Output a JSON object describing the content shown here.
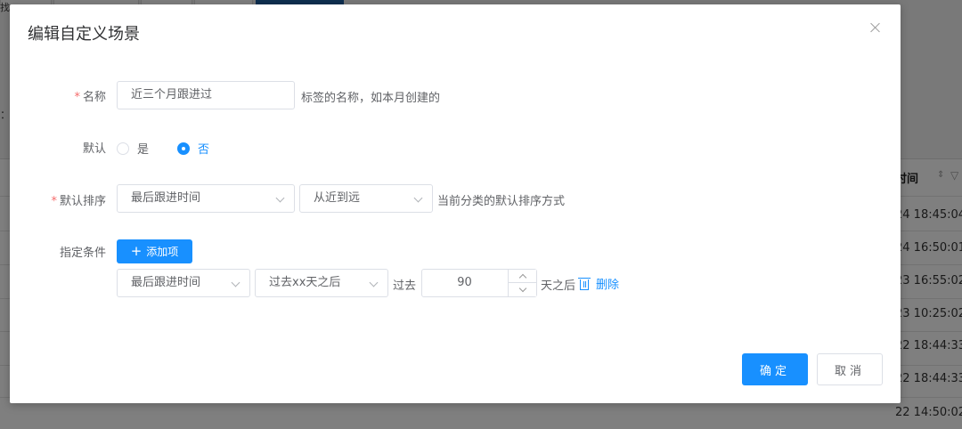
{
  "background": {
    "left_cut_text": "找",
    "left_colon": "：",
    "column_header": "时间",
    "rows": [
      "24 18:45:04",
      "24 16:50:01",
      "23 16:55:02",
      "23 10:25:02",
      "22 18:44:33",
      "22 18:44:33",
      "22 14:50:02"
    ]
  },
  "dialog": {
    "title": "编辑自定义场景",
    "name": {
      "label": "名称",
      "value": "近三个月跟进过",
      "hint": "标签的名称，如本月创建的"
    },
    "default": {
      "label": "默认",
      "options": [
        "是",
        "否"
      ],
      "selected": "否"
    },
    "sort": {
      "label": "默认排序",
      "field": "最后跟进时间",
      "order": "从近到远",
      "hint": "当前分类的默认排序方式"
    },
    "conditions": {
      "label": "指定条件",
      "add_label": "添加项",
      "items": [
        {
          "field": "最后跟进时间",
          "operator": "过去xx天之后",
          "prefix": "过去",
          "value": "90",
          "suffix": "天之后",
          "delete_label": "删除"
        }
      ]
    },
    "ok_label": "确定",
    "cancel_label": "取消"
  },
  "colors": {
    "primary": "#1890ff",
    "required": "#f56c6c",
    "overlay": "rgba(0,0,0,0.5)"
  }
}
